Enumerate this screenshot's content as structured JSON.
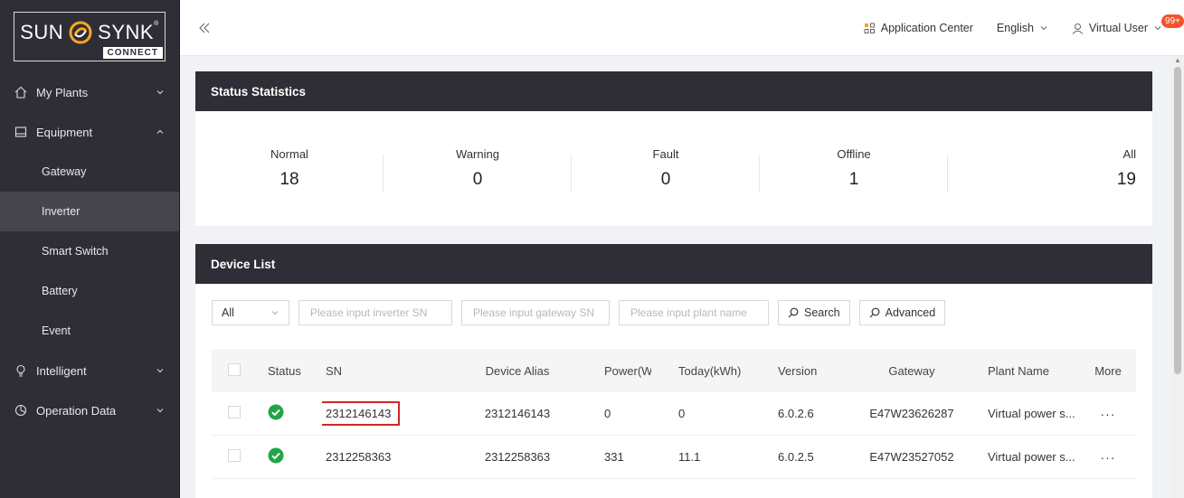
{
  "brand": {
    "word1": "SUN",
    "word2": "SYNK",
    "reg": "®",
    "sub": "CONNECT"
  },
  "sidebar": {
    "items": [
      {
        "label": "My Plants",
        "icon": "home-icon",
        "expanded": false
      },
      {
        "label": "Equipment",
        "icon": "equipment-icon",
        "expanded": true,
        "children": [
          "Gateway",
          "Inverter",
          "Smart Switch",
          "Battery",
          "Event"
        ],
        "active_child": "Inverter"
      },
      {
        "label": "Intelligent",
        "icon": "bulb-icon",
        "expanded": false
      },
      {
        "label": "Operation Data",
        "icon": "chart-icon",
        "expanded": false
      }
    ]
  },
  "topbar": {
    "app_center": "Application Center",
    "language": "English",
    "user": "Virtual User",
    "badge": "99+"
  },
  "status_card": {
    "title": "Status Statistics",
    "stats": [
      {
        "label": "Normal",
        "value": "18"
      },
      {
        "label": "Warning",
        "value": "0"
      },
      {
        "label": "Fault",
        "value": "0"
      },
      {
        "label": "Offline",
        "value": "1"
      },
      {
        "label": "All",
        "value": "19"
      }
    ]
  },
  "device_card": {
    "title": "Device List",
    "filter": {
      "select_value": "All",
      "inverter_sn_placeholder": "Please input inverter SN",
      "gateway_sn_placeholder": "Please input gateway SN",
      "plant_placeholder": "Please input plant name",
      "search_label": "Search",
      "advanced_label": "Advanced"
    },
    "columns": [
      "Status",
      "SN",
      "Device Alias",
      "Power(W)",
      "Today(kWh)",
      "Version",
      "Gateway",
      "Plant Name",
      "More"
    ],
    "rows": [
      {
        "sn": "2312146143",
        "alias": "2312146143",
        "power": "0",
        "today": "0",
        "version": "6.0.2.6",
        "gateway": "E47W23626287",
        "plant": "Virtual power s...",
        "more": "···"
      },
      {
        "sn": "2312258363",
        "alias": "2312258363",
        "power": "331",
        "today": "11.1",
        "version": "6.0.2.5",
        "gateway": "E47W23527052",
        "plant": "Virtual power s...",
        "more": "···"
      }
    ]
  },
  "colors": {
    "sidebar_bg": "#2f2e36",
    "header_bg": "#2f2e36",
    "status_ok": "#21a645",
    "highlight": "#d12626",
    "badge": "#f5532d"
  }
}
